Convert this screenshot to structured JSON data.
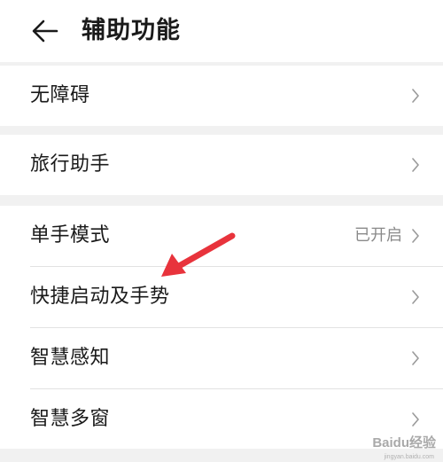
{
  "header": {
    "title": "辅助功能",
    "back_icon": "arrow-left-icon"
  },
  "groups": [
    {
      "items": [
        {
          "label": "无障碍",
          "status": ""
        }
      ]
    },
    {
      "items": [
        {
          "label": "旅行助手",
          "status": ""
        }
      ]
    },
    {
      "items": [
        {
          "label": "单手模式",
          "status": "已开启"
        },
        {
          "label": "快捷启动及手势",
          "status": ""
        },
        {
          "label": "智慧感知",
          "status": ""
        },
        {
          "label": "智慧多窗",
          "status": ""
        }
      ]
    }
  ],
  "annotation": {
    "arrow_color": "#e8333c",
    "arrow_icon": "red-arrow-icon"
  },
  "watermark": {
    "text": "Baidu经验",
    "sub": "jingyan.baidu.com"
  },
  "colors": {
    "background": "#f1f1f1",
    "card": "#ffffff",
    "text": "#1a1a1a",
    "secondary_text": "#8a8a8a"
  }
}
